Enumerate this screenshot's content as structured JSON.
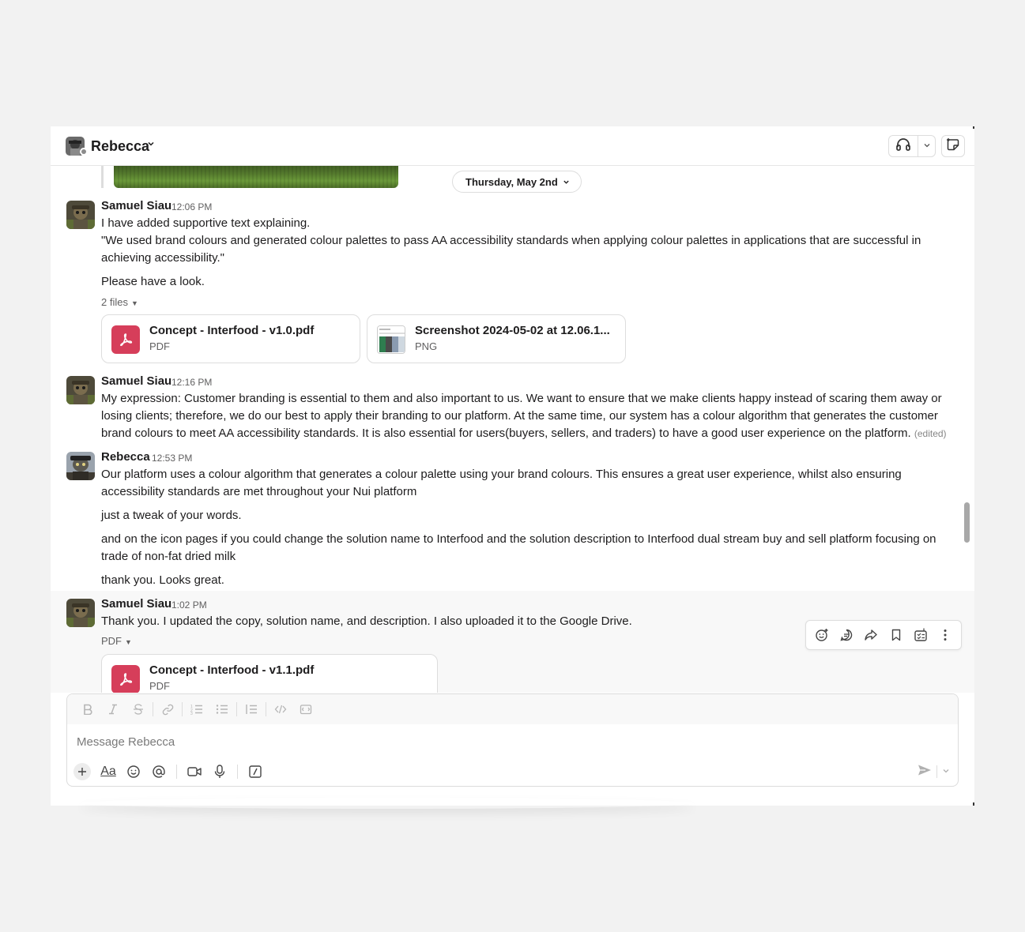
{
  "header": {
    "title": "Rebecca",
    "presence": "away"
  },
  "date_divider": "Thursday, May 2nd",
  "messages": [
    {
      "author": "Samuel Siau",
      "time": "12:06 PM",
      "paragraphs": [
        "I have added supportive text explaining.",
        "\"We used brand colours and generated colour palettes to pass AA accessibility standards when applying colour palettes in applications that are successful in achieving accessibility.\"",
        "Please have a look."
      ],
      "files_label": "2 files",
      "files": [
        {
          "name": "Concept - Interfood - v1.0.pdf",
          "type": "PDF",
          "icon": "pdf-icon"
        },
        {
          "name": "Screenshot 2024-05-02 at 12.06.1...",
          "type": "PNG",
          "icon": "image-thumbnail"
        }
      ]
    },
    {
      "author": "Samuel Siau",
      "time": "12:16 PM",
      "paragraphs": [
        "My expression: Customer branding is essential to them and also important to us. We want to ensure that we make clients happy instead of scaring them away or losing clients; therefore, we do our best to apply their branding to our platform. At the same time, our system has a colour algorithm that generates the customer brand colours to meet AA accessibility standards. It is also essential for users(buyers, sellers, and traders) to have a good user experience on the platform."
      ],
      "edited": "(edited)"
    },
    {
      "author": "Rebecca",
      "time": "12:53 PM",
      "paragraphs": [
        "Our platform uses a colour algorithm that generates a colour palette using your brand colours.  This ensures a great user experience, whilst also ensuring accessibility standards are met throughout your Nui platform",
        "just a tweak of your words.",
        "and on the icon pages if you could change the solution name to Interfood and the solution description to Interfood dual stream buy and sell platform focusing on trade of non-fat dried milk",
        "thank you.  Looks great."
      ]
    },
    {
      "author": "Samuel Siau",
      "time": "1:02 PM",
      "paragraphs": [
        "Thank you. I updated the copy, solution name, and description. I also uploaded it to the Google Drive."
      ],
      "files_label": "PDF",
      "files": [
        {
          "name": "Concept - Interfood - v1.1.pdf",
          "type": "PDF",
          "icon": "pdf-icon"
        }
      ]
    }
  ],
  "composer": {
    "placeholder": "Message Rebecca",
    "format_label": "Aa"
  },
  "colors": {
    "pdf_icon": "#d63e5a",
    "hover_bg": "#f8f8f8",
    "timestamp": "#616061"
  }
}
